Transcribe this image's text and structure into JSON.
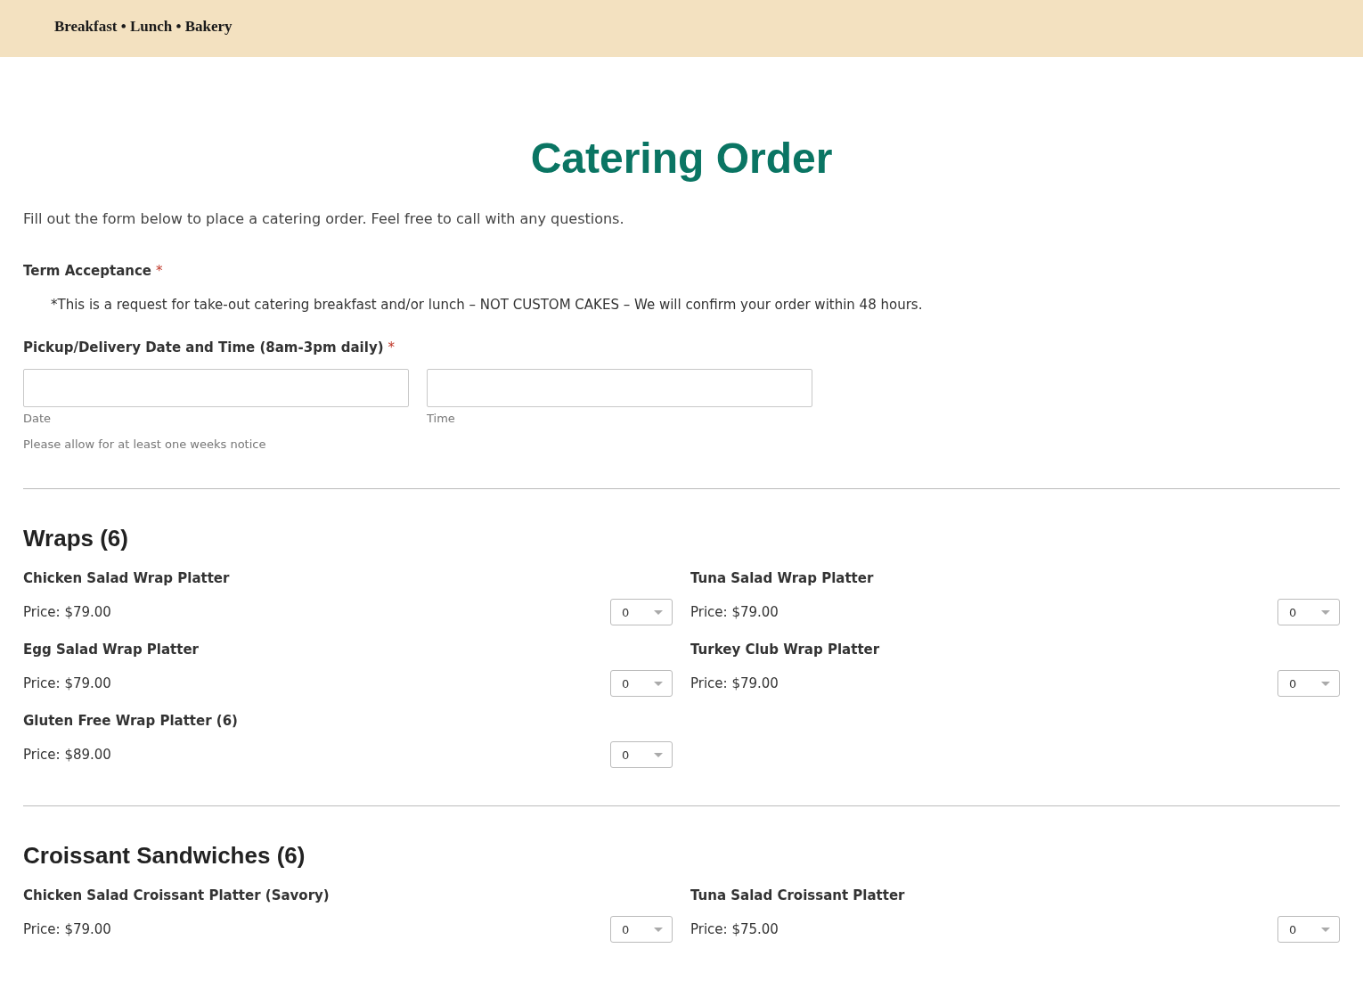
{
  "header": {
    "tagline": "Breakfast • Lunch • Bakery"
  },
  "page": {
    "title": "Catering Order",
    "intro": "Fill out the form below to place a catering order. Feel free to call with any questions."
  },
  "terms": {
    "label": "Term Acceptance",
    "required_mark": "*",
    "text": "*This is a request for take-out catering breakfast and/or lunch – NOT CUSTOM CAKES – We will confirm your order within 48 hours."
  },
  "pickup": {
    "label": "Pickup/Delivery Date and Time (8am-3pm daily)",
    "required_mark": "*",
    "fields": [
      {
        "sublabel": "Date"
      },
      {
        "sublabel": "Time"
      }
    ],
    "note": "Please allow for at least one weeks notice"
  },
  "sections": [
    {
      "title": "Wraps (6)",
      "items": [
        {
          "name": "Chicken Salad Wrap Platter",
          "price": "Price: $79.00",
          "quantity": "0"
        },
        {
          "name": "Tuna Salad Wrap Platter",
          "price": "Price: $79.00",
          "quantity": "0"
        },
        {
          "name": "Egg Salad Wrap Platter",
          "price": "Price: $79.00",
          "quantity": "0"
        },
        {
          "name": "Turkey Club Wrap Platter",
          "price": "Price: $79.00",
          "quantity": "0"
        },
        {
          "name": "Gluten Free Wrap Platter (6)",
          "price": "Price: $89.00",
          "quantity": "0"
        }
      ]
    },
    {
      "title": "Croissant Sandwiches (6)",
      "items": [
        {
          "name": "Chicken Salad Croissant Platter (Savory)",
          "price": "Price: $79.00",
          "quantity": "0"
        },
        {
          "name": "Tuna Salad Croissant Platter",
          "price": "Price: $75.00",
          "quantity": "0"
        }
      ]
    }
  ]
}
